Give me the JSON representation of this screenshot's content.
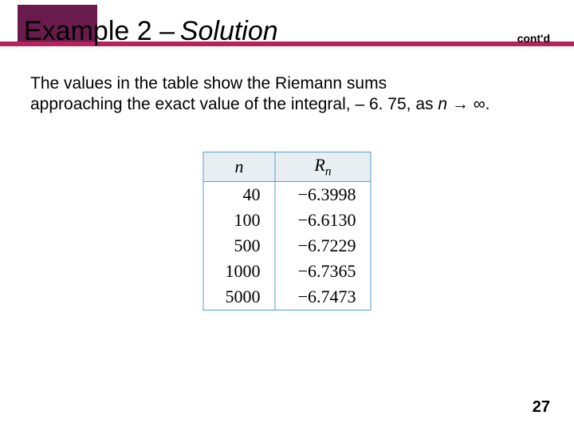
{
  "header": {
    "title_plain": "Example 2 – ",
    "title_ital": "Solution",
    "contd": "cont'd"
  },
  "body": {
    "line1": "The values in the table show the Riemann sums",
    "line2a": "approaching the exact value of the integral, – 6. 75, as ",
    "line2_n": "n",
    "line2_arrow": " → ∞",
    "line2_dot": "."
  },
  "table": {
    "header_n": "n",
    "header_R": "R",
    "header_R_sub": "n"
  },
  "chart_data": {
    "type": "table",
    "title": "Riemann sums approaching −6.75",
    "columns": [
      "n",
      "Rn"
    ],
    "rows": [
      {
        "n": 40,
        "Rn": -6.3998
      },
      {
        "n": 100,
        "Rn": -6.613
      },
      {
        "n": 500,
        "Rn": -6.7229
      },
      {
        "n": 1000,
        "Rn": -6.7365
      },
      {
        "n": 5000,
        "Rn": -6.7473
      }
    ],
    "limit_value": -6.75,
    "display": {
      "n": [
        "40",
        "100",
        "500",
        "1000",
        "5000"
      ],
      "Rn": [
        "−6.3998",
        "−6.6130",
        "−6.7229",
        "−6.7365",
        "−6.7473"
      ]
    }
  },
  "pagenum": "27"
}
